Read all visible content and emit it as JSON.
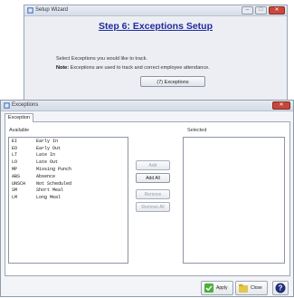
{
  "setup_wizard": {
    "title": "Setup Wizard",
    "step_title": "Step 6: Exceptions Setup",
    "instruction": "Select Exceptions you would like to track.",
    "note_label": "Note:",
    "note_text": " Exceptions are used to track and correct employee attendance.",
    "button_label": "(7) Exceptions"
  },
  "exceptions_window": {
    "title": "Exceptions",
    "tabs": [
      {
        "label": "Exception"
      }
    ],
    "available_label": "Available",
    "selected_label": "Selected",
    "available_items": [
      {
        "code": "EI",
        "desc": "Early In"
      },
      {
        "code": "EO",
        "desc": "Early Out"
      },
      {
        "code": "LT",
        "desc": "Late In"
      },
      {
        "code": "LO",
        "desc": "Late Out"
      },
      {
        "code": "MP",
        "desc": "Missing Punch"
      },
      {
        "code": "ABS",
        "desc": "Absence"
      },
      {
        "code": "UNSCH",
        "desc": "Not Scheduled"
      },
      {
        "code": "SM",
        "desc": "Short Meal"
      },
      {
        "code": "LM",
        "desc": "Long Meal"
      }
    ],
    "buttons": {
      "add": "Add",
      "add_all": "Add All",
      "remove": "Remove",
      "remove_all": "Remove All"
    },
    "footer": {
      "apply": "Apply",
      "close": "Close"
    }
  },
  "colors": {
    "step_title": "#1f2a9e",
    "close_button": "#c6463a",
    "apply_icon": "#4caf3a",
    "close_icon": "#e3c64b"
  }
}
